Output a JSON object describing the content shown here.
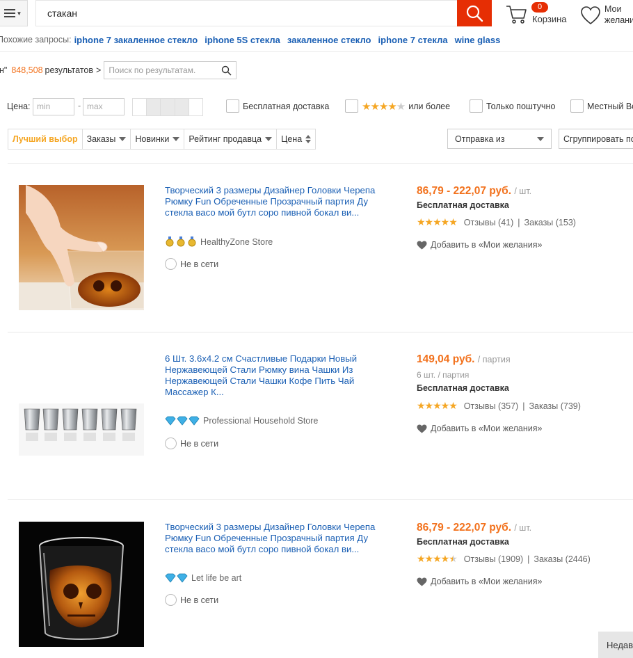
{
  "header": {
    "search_value": "стакан",
    "cart_count": "0",
    "cart_label": "Корзина",
    "wishlist_label_line1": "Мои",
    "wishlist_label_line2": "желания"
  },
  "related": {
    "label": "Похожие запросы:",
    "links": [
      "iphone 7 закаленное стекло",
      "iphone 5S стекла",
      "закаленное стекло",
      "iphone 7 стекла",
      "wine glass"
    ]
  },
  "results": {
    "query_tail": "н\"",
    "count": "848,508",
    "label": "результатов",
    "arrow": ">",
    "sub_search_placeholder": "Поиск по результатам."
  },
  "filters": {
    "price_label": "Цена:",
    "min_placeholder": "min",
    "max_placeholder": "max",
    "dash": "-",
    "free_shipping": "Бесплатная доставка",
    "rating_suffix": "или более",
    "single_only": "Только поштучно",
    "local_warehouse": "Местный Вс"
  },
  "sort": {
    "items": [
      "Лучший выбор",
      "Заказы",
      "Новинки",
      "Рейтинг продавца",
      "Цена"
    ],
    "ship_from": "Отправка из",
    "group_by": "Сгруппировать по"
  },
  "products": [
    {
      "title": "Творческий 3 размеры Дизайнер Головки Черепа Рюмку Fun Обреченные Прозрачный партия Ду стекла васо мой бутл соро пивной бокал ви...",
      "store": "HealthyZone Store",
      "online": "Не в сети",
      "price": "86,79 - 222,07 руб.",
      "unit": "/ шт.",
      "lot": "",
      "free_shipping": "Бесплатная доставка",
      "reviews": "Отзывы (41)",
      "orders": "Заказы (153)",
      "wish": "Добавить в «Мои желания»",
      "rating": 5
    },
    {
      "title": "6 Шт. 3.6x4.2 см Счастливые Подарки Новый Нержавеющей Стали Рюмку вина Чашки Из Нержавеющей Стали Чашки Кофе Пить Чай Массажер К...",
      "store": "Professional Household Store",
      "online": "Не в сети",
      "price": "149,04 руб.",
      "unit": "/ партия",
      "lot": "6 шт. / партия",
      "free_shipping": "Бесплатная доставка",
      "reviews": "Отзывы (357)",
      "orders": "Заказы (739)",
      "wish": "Добавить в «Мои желания»",
      "rating": 5
    },
    {
      "title": "Творческий 3 размеры Дизайнер Головки Черепа Рюмку Fun Обреченные Прозрачный партия Ду стекла васо мой бутл соро пивной бокал ви...",
      "store": "Let life be art",
      "online": "Не в сети",
      "price": "86,79 - 222,07 руб.",
      "unit": "/ шт.",
      "lot": "",
      "free_shipping": "Бесплатная доставка",
      "reviews": "Отзывы (1909)",
      "orders": "Заказы (2446)",
      "wish": "Добавить в «Мои желания»",
      "rating": 4.5
    }
  ],
  "recently_viewed": "Недав",
  "colors": {
    "accent": "#e62e04",
    "price": "#f2711c",
    "link": "#1a5fb4",
    "star": "#f5a623"
  }
}
